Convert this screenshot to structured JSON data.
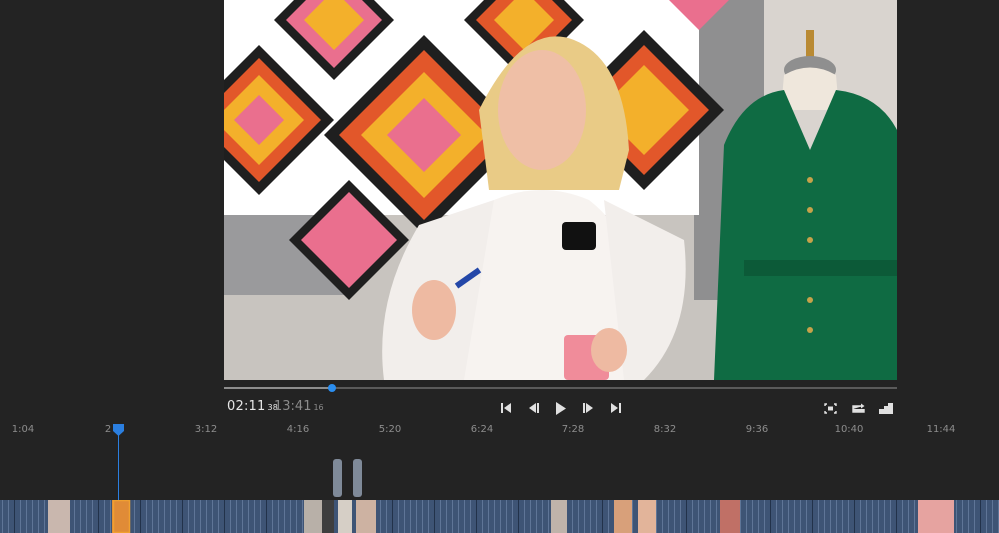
{
  "player": {
    "current_time": "02:11",
    "current_frames": "38",
    "duration": "13:41",
    "duration_frames": "16",
    "progress": 0.16
  },
  "controls": {
    "icons": [
      "skip-to-start-icon",
      "step-back-icon",
      "play-icon",
      "step-forward-icon",
      "skip-to-end-icon",
      "fit-screen-icon",
      "loop-icon",
      "quality-icon"
    ]
  },
  "ruler": {
    "ticks": [
      "1:04",
      "2",
      "3:12",
      "4:16",
      "5:20",
      "6:24",
      "7:28",
      "8:32",
      "9:36",
      "10:40",
      "11:44"
    ]
  },
  "colors": {
    "accent": "#2b8ef0",
    "background": "#232323",
    "clip_strip": "#3e5475"
  }
}
